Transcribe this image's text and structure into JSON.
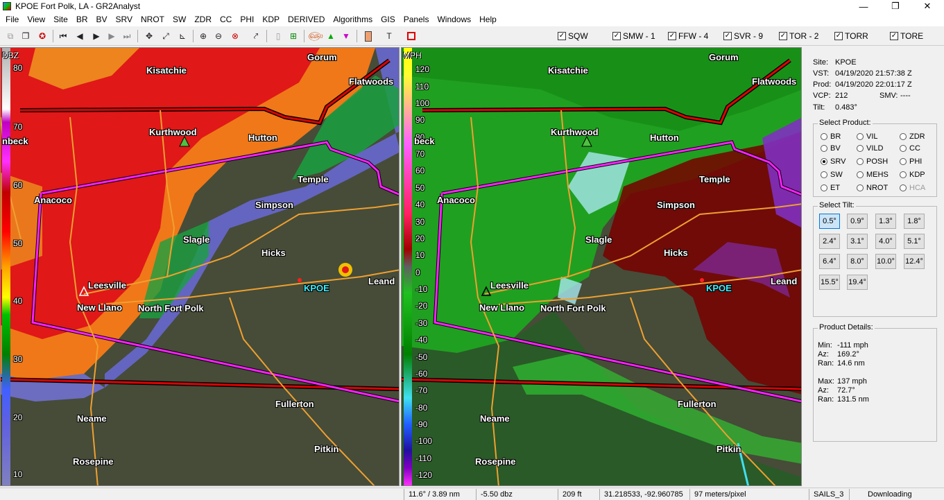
{
  "window": {
    "title": "KPOE Fort Polk, LA - GR2Analyst",
    "minimize": "—",
    "maximize": "❐",
    "close": "✕"
  },
  "menu": [
    "File",
    "View",
    "Site",
    "BR",
    "BV",
    "SRV",
    "NROT",
    "SW",
    "ZDR",
    "CC",
    "PHI",
    "KDP",
    "DERIVED",
    "Algorithms",
    "GIS",
    "Panels",
    "Windows",
    "Help"
  ],
  "warnings": [
    {
      "label": "SQW",
      "checked": true
    },
    {
      "label": "SMW - 1",
      "checked": true
    },
    {
      "label": "FFW - 4",
      "checked": true
    },
    {
      "label": "SVR - 9",
      "checked": true
    },
    {
      "label": "TOR - 2",
      "checked": true
    },
    {
      "label": "TORR",
      "checked": true
    },
    {
      "label": "TORE",
      "checked": true
    }
  ],
  "left_pane": {
    "units": "DBZ",
    "ticks": [
      "80",
      "70",
      "60",
      "50",
      "40",
      "30",
      "20",
      "10"
    ]
  },
  "right_pane": {
    "units": "MPH",
    "ticks": [
      "120",
      "110",
      "100",
      "90",
      "80",
      "70",
      "60",
      "50",
      "40",
      "30",
      "20",
      "10",
      "0",
      "-10",
      "-20",
      "-30",
      "-40",
      "-50",
      "-60",
      "-70",
      "-80",
      "-90",
      "-100",
      "-110",
      "-120"
    ]
  },
  "towns": {
    "gorum": "Gorum",
    "kisatchie": "Kisatchie",
    "flatwoods": "Flatwoods",
    "kurthwood": "Kurthwood",
    "hutton": "Hutton",
    "beck": "nbeck",
    "beck_right": "beck",
    "temple": "Temple",
    "anacoco": "Anacoco",
    "simpson": "Simpson",
    "slagle": "Slagle",
    "hicks": "Hicks",
    "leesville": "Leesville",
    "new_llano": "New Llano",
    "north_fort_polk": "North Fort Polk",
    "kpoe": "KPOE",
    "leand": "Leand",
    "fullerton": "Fullerton",
    "neame": "Neame",
    "pitkin": "Pitkin",
    "rosepine": "Rosepine"
  },
  "site_info": {
    "site_key": "Site:",
    "site": "KPOE",
    "vst_key": "VST:",
    "vst": "04/19/2020  21:57:38 Z",
    "prod_key": "Prod:",
    "prod": "04/19/2020  22:01:17 Z",
    "vcp_key": "VCP:",
    "vcp": "212",
    "smv_key": "SMV:",
    "smv": "----",
    "tilt_key": "Tilt:",
    "tilt": "0.483°"
  },
  "select_product": {
    "title": "Select Product:",
    "items": [
      {
        "label": "BR",
        "selected": false,
        "enabled": true
      },
      {
        "label": "VIL",
        "selected": false,
        "enabled": true
      },
      {
        "label": "ZDR",
        "selected": false,
        "enabled": true
      },
      {
        "label": "BV",
        "selected": false,
        "enabled": true
      },
      {
        "label": "VILD",
        "selected": false,
        "enabled": true
      },
      {
        "label": "CC",
        "selected": false,
        "enabled": true
      },
      {
        "label": "SRV",
        "selected": true,
        "enabled": true
      },
      {
        "label": "POSH",
        "selected": false,
        "enabled": true
      },
      {
        "label": "PHI",
        "selected": false,
        "enabled": true
      },
      {
        "label": "SW",
        "selected": false,
        "enabled": true
      },
      {
        "label": "MEHS",
        "selected": false,
        "enabled": true
      },
      {
        "label": "KDP",
        "selected": false,
        "enabled": true
      },
      {
        "label": "ET",
        "selected": false,
        "enabled": true
      },
      {
        "label": "NROT",
        "selected": false,
        "enabled": true
      },
      {
        "label": "HCA",
        "selected": false,
        "enabled": false
      }
    ]
  },
  "select_tilt": {
    "title": "Select Tilt:",
    "items": [
      "0.5°",
      "0.9°",
      "1.3°",
      "1.8°",
      "2.4°",
      "3.1°",
      "4.0°",
      "5.1°",
      "6.4°",
      "8.0°",
      "10.0°",
      "12.4°",
      "15.5°",
      "19.4°"
    ],
    "selected": "0.5°"
  },
  "product_details": {
    "title": "Product Details:",
    "min_key": "Min:",
    "min": "-111 mph",
    "az1_key": "Az:",
    "az1": "169.2°",
    "ran1_key": "Ran:",
    "ran1": "14.6 nm",
    "max_key": "Max:",
    "max": "137 mph",
    "az2_key": "Az:",
    "az2": "72.7°",
    "ran2_key": "Ran:",
    "ran2": "131.5 nm"
  },
  "status": {
    "angle": "11.6° / 3.89 nm",
    "value": "-5.50 dbz",
    "height": "209 ft",
    "coords": "31.218533, -92.960785",
    "scale": "97 meters/pixel",
    "mode": "SAILS_3",
    "state": "Downloading"
  },
  "colors": {
    "warning_tor": "#e00000",
    "warning_svr": "#ff20ff",
    "roads": "#f0a030",
    "site_marker": "#ff2020"
  }
}
